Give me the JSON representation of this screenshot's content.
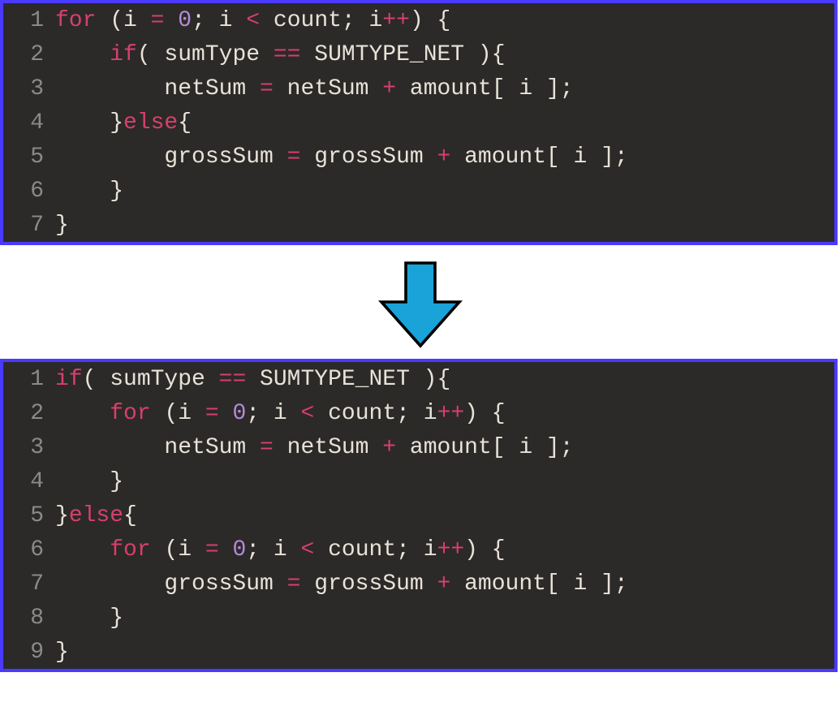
{
  "block1": {
    "lines": [
      {
        "n": "1",
        "tokens": [
          {
            "t": "for",
            "c": "kw"
          },
          {
            "t": " (i ",
            "c": "op"
          },
          {
            "t": "=",
            "c": "kw"
          },
          {
            "t": " ",
            "c": "op"
          },
          {
            "t": "0",
            "c": "num"
          },
          {
            "t": "; i ",
            "c": "op"
          },
          {
            "t": "<",
            "c": "kw"
          },
          {
            "t": " count; i",
            "c": "op"
          },
          {
            "t": "++",
            "c": "kw"
          },
          {
            "t": ") {",
            "c": "op"
          }
        ]
      },
      {
        "n": "2",
        "tokens": [
          {
            "t": "    ",
            "c": "op"
          },
          {
            "t": "if",
            "c": "kw"
          },
          {
            "t": "( sumType ",
            "c": "op"
          },
          {
            "t": "==",
            "c": "kw"
          },
          {
            "t": " SUMTYPE_NET ){",
            "c": "op"
          }
        ]
      },
      {
        "n": "3",
        "tokens": [
          {
            "t": "        netSum ",
            "c": "op"
          },
          {
            "t": "=",
            "c": "kw"
          },
          {
            "t": " netSum ",
            "c": "op"
          },
          {
            "t": "+",
            "c": "kw"
          },
          {
            "t": " amount[ i ];",
            "c": "op"
          }
        ]
      },
      {
        "n": "4",
        "tokens": [
          {
            "t": "    }",
            "c": "op"
          },
          {
            "t": "else",
            "c": "kw"
          },
          {
            "t": "{",
            "c": "op"
          }
        ]
      },
      {
        "n": "5",
        "tokens": [
          {
            "t": "        grossSum ",
            "c": "op"
          },
          {
            "t": "=",
            "c": "kw"
          },
          {
            "t": " grossSum ",
            "c": "op"
          },
          {
            "t": "+",
            "c": "kw"
          },
          {
            "t": " amount[ i ];",
            "c": "op"
          }
        ]
      },
      {
        "n": "6",
        "tokens": [
          {
            "t": "    }",
            "c": "op"
          }
        ]
      },
      {
        "n": "7",
        "tokens": [
          {
            "t": "}",
            "c": "op"
          }
        ]
      }
    ]
  },
  "block2": {
    "lines": [
      {
        "n": "1",
        "tokens": [
          {
            "t": "if",
            "c": "kw"
          },
          {
            "t": "( sumType ",
            "c": "op"
          },
          {
            "t": "==",
            "c": "kw"
          },
          {
            "t": " SUMTYPE_NET ){",
            "c": "op"
          }
        ]
      },
      {
        "n": "2",
        "tokens": [
          {
            "t": "    ",
            "c": "op"
          },
          {
            "t": "for",
            "c": "kw"
          },
          {
            "t": " (i ",
            "c": "op"
          },
          {
            "t": "=",
            "c": "kw"
          },
          {
            "t": " ",
            "c": "op"
          },
          {
            "t": "0",
            "c": "num"
          },
          {
            "t": "; i ",
            "c": "op"
          },
          {
            "t": "<",
            "c": "kw"
          },
          {
            "t": " count; i",
            "c": "op"
          },
          {
            "t": "++",
            "c": "kw"
          },
          {
            "t": ") {",
            "c": "op"
          }
        ]
      },
      {
        "n": "3",
        "tokens": [
          {
            "t": "        netSum ",
            "c": "op"
          },
          {
            "t": "=",
            "c": "kw"
          },
          {
            "t": " netSum ",
            "c": "op"
          },
          {
            "t": "+",
            "c": "kw"
          },
          {
            "t": " amount[ i ];",
            "c": "op"
          }
        ]
      },
      {
        "n": "4",
        "tokens": [
          {
            "t": "    }",
            "c": "op"
          }
        ]
      },
      {
        "n": "5",
        "tokens": [
          {
            "t": "}",
            "c": "op"
          },
          {
            "t": "else",
            "c": "kw"
          },
          {
            "t": "{",
            "c": "op"
          }
        ]
      },
      {
        "n": "6",
        "tokens": [
          {
            "t": "    ",
            "c": "op"
          },
          {
            "t": "for",
            "c": "kw"
          },
          {
            "t": " (i ",
            "c": "op"
          },
          {
            "t": "=",
            "c": "kw"
          },
          {
            "t": " ",
            "c": "op"
          },
          {
            "t": "0",
            "c": "num"
          },
          {
            "t": "; i ",
            "c": "op"
          },
          {
            "t": "<",
            "c": "kw"
          },
          {
            "t": " count; i",
            "c": "op"
          },
          {
            "t": "++",
            "c": "kw"
          },
          {
            "t": ") {",
            "c": "op"
          }
        ]
      },
      {
        "n": "7",
        "tokens": [
          {
            "t": "        grossSum ",
            "c": "op"
          },
          {
            "t": "=",
            "c": "kw"
          },
          {
            "t": " grossSum ",
            "c": "op"
          },
          {
            "t": "+",
            "c": "kw"
          },
          {
            "t": " amount[ i ];",
            "c": "op"
          }
        ]
      },
      {
        "n": "8",
        "tokens": [
          {
            "t": "    }",
            "c": "op"
          }
        ]
      },
      {
        "n": "9",
        "tokens": [
          {
            "t": "}",
            "c": "op"
          }
        ]
      }
    ]
  }
}
